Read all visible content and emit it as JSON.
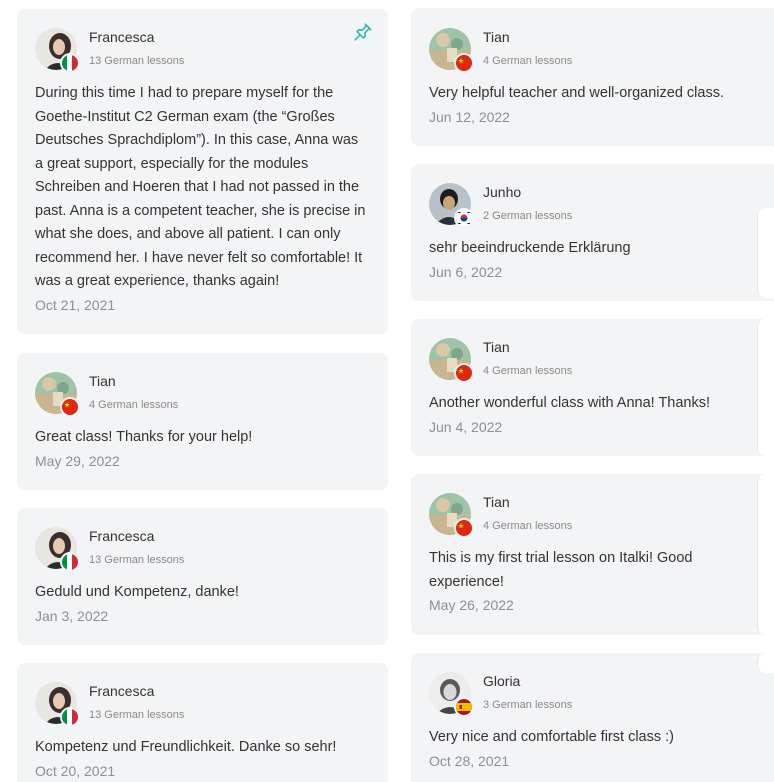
{
  "reviews_left": [
    {
      "name": "Francesca",
      "lessons": "13 German lessons",
      "text": "During this time I had to prepare myself for the Goethe-Institut C2 German exam (the “Großes Deutsches Sprachdiplom”). In this case, Anna was a great support, especially for the modules Schreiben and Hoeren that I had not passed in the past. Anna is a competent teacher, she is precise in what she does, and above all patient. I can only recommend her. I have never felt so comfortable! It was a great experience, thanks again!",
      "date": "Oct 21, 2021",
      "flag": "italy-flag",
      "pinned": true
    },
    {
      "name": "Tian",
      "lessons": "4 German lessons",
      "text": "Great class! Thanks for your help!",
      "date": "May 29, 2022",
      "flag": "china-flag"
    },
    {
      "name": "Francesca",
      "lessons": "13 German lessons",
      "text": "Geduld und Kompetenz, danke!",
      "date": "Jan 3, 2022",
      "flag": "italy-flag"
    },
    {
      "name": "Francesca",
      "lessons": "13 German lessons",
      "text": "Kompetenz und Freundlichkeit. Danke so sehr!",
      "date": "Oct 20, 2021",
      "flag": "italy-flag"
    }
  ],
  "reviews_right": [
    {
      "name": "Tian",
      "lessons": "4 German lessons",
      "text": "Very helpful teacher and well-organized class.",
      "date": "Jun 12, 2022",
      "flag": "china-flag"
    },
    {
      "name": "Junho",
      "lessons": "2 German lessons",
      "text": "sehr beeindruckende Erklärung",
      "date": "Jun 6, 2022",
      "flag": "korea-flag"
    },
    {
      "name": "Tian",
      "lessons": "4 German lessons",
      "text": "Another wonderful class with Anna! Thanks!",
      "date": "Jun 4, 2022",
      "flag": "china-flag"
    },
    {
      "name": "Tian",
      "lessons": "4 German lessons",
      "text": "This is my first trial lesson on Italki! Good experience!",
      "date": "May 26, 2022",
      "flag": "china-flag"
    },
    {
      "name": "Gloria",
      "lessons": "3 German lessons",
      "text": "Very nice and comfortable first class :)",
      "date": "Oct 28, 2021",
      "flag": "spain-flag"
    }
  ],
  "colors": {
    "card_bg": "#f3f4f6",
    "pin_icon": "#2ab7a9",
    "date_text": "#8a8f98",
    "meta_text": "#8a8a8a"
  },
  "icons": {
    "pin": "pin-icon"
  }
}
